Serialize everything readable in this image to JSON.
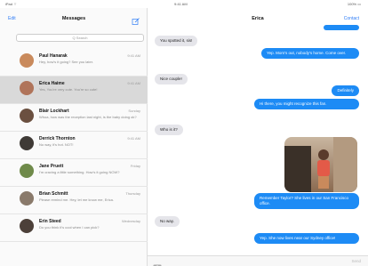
{
  "status": {
    "carrier": "iPad ⌔",
    "time": "9:41 AM",
    "battery": "100% ▭"
  },
  "sidebar": {
    "edit_label": "Edit",
    "title": "Messages",
    "compose_icon": "compose-icon",
    "search_placeholder": "Q Search",
    "items": [
      {
        "name": "Paul Hanarak",
        "date": "9:41 AM",
        "preview": "Hey, how's it going? See you later.",
        "avatar_color": "#c98a5c"
      },
      {
        "name": "Erica Haime",
        "date": "9:41 AM",
        "preview": "Yes, You're very cute. You're so cute!",
        "avatar_color": "#b0745a"
      },
      {
        "name": "Blair Lockhart",
        "date": "Sunday",
        "preview": "Whoa, how was the reception last night, is the baby doing ok?",
        "avatar_color": "#6b5040"
      },
      {
        "name": "Derrick Thornton",
        "date": "9:41 AM",
        "preview": "No way, it's hot. NOT!",
        "avatar_color": "#3f3a36"
      },
      {
        "name": "Jane Pruett",
        "date": "Friday",
        "preview": "I'm craving a little something. How's it going NOW?",
        "avatar_color": "#6f8a4a"
      },
      {
        "name": "Brian Schmitt",
        "date": "Thursday",
        "preview": "Please remind me. Hey, let me know me, Erica.",
        "avatar_color": "#8a7a6b"
      },
      {
        "name": "Erin Steed",
        "date": "Wednesday",
        "preview": "Do you think it's cool when I can pick?",
        "avatar_color": "#4c4039"
      }
    ]
  },
  "conversation": {
    "title": "Erica",
    "contact_label": "Contact",
    "messages": [
      {
        "dir": "in",
        "text": "You spotted it, sis!"
      },
      {
        "dir": "out",
        "text": "Yep. Mom's out, nobody's home. Come over."
      },
      {
        "dir": "in",
        "text": "Nice couple!"
      },
      {
        "dir": "out",
        "text": "Definitely"
      },
      {
        "dir": "out",
        "text": "Hi there, you might recognize this fan."
      },
      {
        "dir": "in",
        "text": "Who is it?"
      },
      {
        "dir": "out",
        "text": "Remember Taylor? She lives in our San Francisco office."
      },
      {
        "dir": "in",
        "text": "No way."
      },
      {
        "dir": "out",
        "text": "Yep. She now lives near our Sydney office!"
      }
    ],
    "input_placeholder": "",
    "send_label": "Send",
    "camera_icon": "camera-icon"
  }
}
